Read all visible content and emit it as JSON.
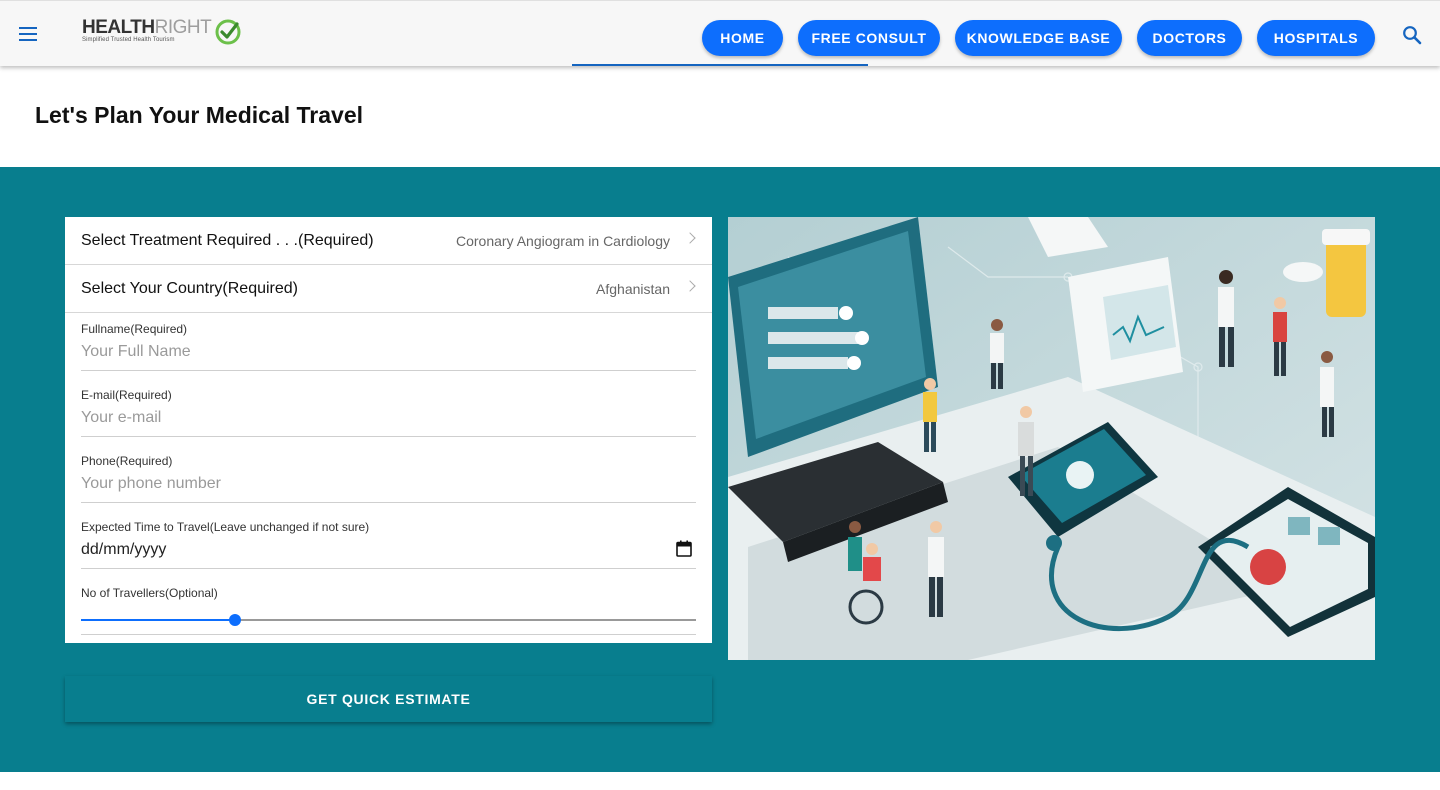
{
  "header": {
    "menu_icon": "hamburger-menu-icon",
    "logo": {
      "brand_bold": "HEALTH",
      "brand_light": "RIGHT",
      "tagline": "Simplified Trusted Health Tourism"
    },
    "nav": [
      {
        "label": "HOME"
      },
      {
        "label": "FREE CONSULT"
      },
      {
        "label": "KNOWLEDGE BASE"
      },
      {
        "label": "DOCTORS"
      },
      {
        "label": "HOSPITALS"
      }
    ],
    "search_icon": "search-icon"
  },
  "page": {
    "title": "Let's Plan Your Medical Travel"
  },
  "form": {
    "treatment": {
      "label": "Select Treatment Required . . .(Required)",
      "value": "Coronary Angiogram in Cardiology"
    },
    "country": {
      "label": "Select Your Country(Required)",
      "value": "Afghanistan"
    },
    "fullname": {
      "label": "Fullname(Required)",
      "placeholder": "Your Full Name",
      "value": ""
    },
    "email": {
      "label": "E-mail(Required)",
      "placeholder": "Your e-mail",
      "value": ""
    },
    "phone": {
      "label": "Phone(Required)",
      "placeholder": "Your phone number",
      "value": ""
    },
    "travel_date": {
      "label": "Expected Time to Travel(Leave unchanged if not sure)",
      "value": "dd/mm/yyyy"
    },
    "travellers": {
      "label": "No of Travellers(Optional)",
      "fraction": 0.25
    },
    "submit_label": "GET QUICK ESTIMATE"
  },
  "colors": {
    "accent_blue": "#0d6efd",
    "teal_section": "#087e8e"
  }
}
